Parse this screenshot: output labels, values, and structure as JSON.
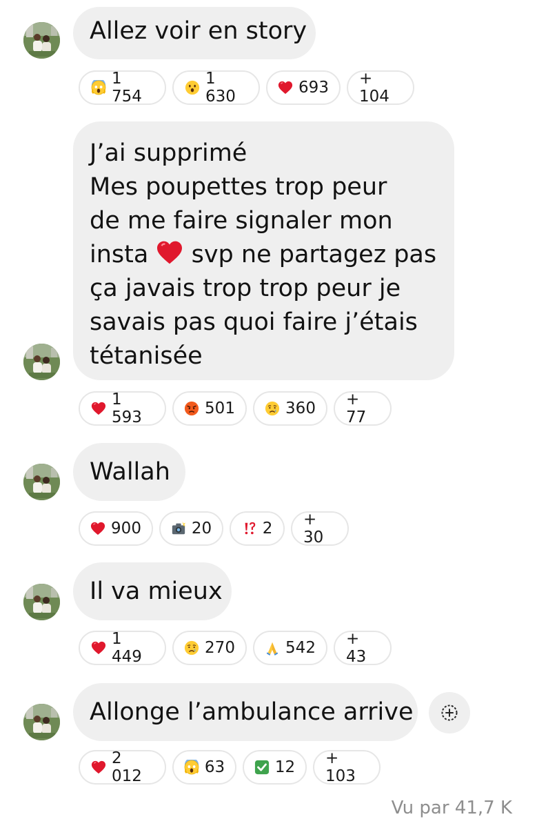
{
  "messages": [
    {
      "lines": [
        "Allez voir en story"
      ],
      "reactions": [
        {
          "icon": "face-screaming-icon",
          "count": "1 754"
        },
        {
          "icon": "face-open-mouth-icon",
          "count": "1 630"
        },
        {
          "icon": "red-heart-icon",
          "count": "693"
        },
        {
          "icon": "",
          "count": "+ 104"
        }
      ]
    },
    {
      "lines": [
        "J’ai supprimé",
        "Mes poupettes trop peur",
        "de me faire signaler mon",
        "insta",
        "svp ne partagez pas",
        "ça javais trop trop peur je",
        "savais pas quoi faire j’étais",
        "tétanisée"
      ],
      "reactions": [
        {
          "icon": "red-heart-icon",
          "count": "1 593"
        },
        {
          "icon": "angry-face-icon",
          "count": "501"
        },
        {
          "icon": "crying-face-icon",
          "count": "360"
        },
        {
          "icon": "",
          "count": "+ 77"
        }
      ]
    },
    {
      "lines": [
        "Wallah"
      ],
      "reactions": [
        {
          "icon": "red-heart-icon",
          "count": "900"
        },
        {
          "icon": "camera-flash-icon",
          "count": "20"
        },
        {
          "icon": "exclamation-question-icon",
          "count": "2"
        },
        {
          "icon": "",
          "count": "+ 30"
        }
      ]
    },
    {
      "lines": [
        "Il va mieux"
      ],
      "reactions": [
        {
          "icon": "red-heart-icon",
          "count": "1 449"
        },
        {
          "icon": "crying-face-icon",
          "count": "270"
        },
        {
          "icon": "folded-hands-icon",
          "count": "542"
        },
        {
          "icon": "",
          "count": "+ 43"
        }
      ]
    },
    {
      "lines": [
        "Allonge l’ambulance arrive"
      ],
      "reactions": [
        {
          "icon": "red-heart-icon",
          "count": "2 012"
        },
        {
          "icon": "face-screaming-icon",
          "count": "63"
        },
        {
          "icon": "check-mark-button-icon",
          "count": "12"
        },
        {
          "icon": "",
          "count": "+ 103"
        }
      ]
    }
  ],
  "seen_by": "Vu par 41,7 K",
  "colors": {
    "bubble": "#efefef",
    "pill_border": "#e6e6e6",
    "muted_text": "#8e8e8e"
  }
}
